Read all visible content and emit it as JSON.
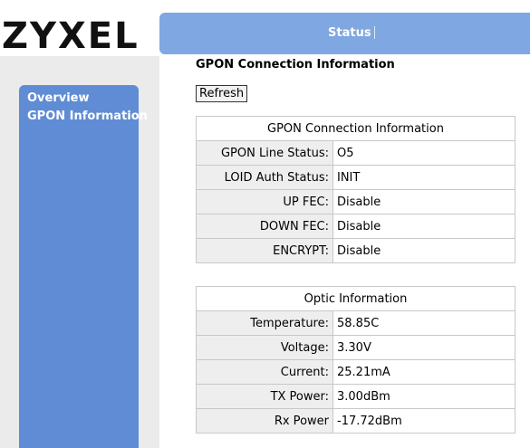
{
  "brand": {
    "logo_text": "ZYXEL"
  },
  "header": {
    "tab_status": "Status"
  },
  "sidebar": {
    "items": [
      {
        "label": "Overview"
      },
      {
        "label": "GPON Information"
      }
    ]
  },
  "main": {
    "title": "GPON Connection Information",
    "refresh_label": "Refresh",
    "gpon_table": {
      "header": "GPON Connection Information",
      "rows": [
        {
          "label": "GPON Line Status:",
          "value": "O5"
        },
        {
          "label": "LOID Auth Status:",
          "value": "INIT"
        },
        {
          "label": "UP FEC:",
          "value": "Disable"
        },
        {
          "label": "DOWN FEC:",
          "value": "Disable"
        },
        {
          "label": "ENCRYPT:",
          "value": "Disable"
        }
      ]
    },
    "optic_table": {
      "header": "Optic Information",
      "rows": [
        {
          "label": "Temperature:",
          "value": "58.85C"
        },
        {
          "label": "Voltage:",
          "value": "3.30V"
        },
        {
          "label": "Current:",
          "value": "25.21mA"
        },
        {
          "label": "TX Power:",
          "value": "3.00dBm"
        },
        {
          "label": "Rx Power",
          "value": "-17.72dBm"
        }
      ]
    }
  },
  "colors": {
    "topbar": "#7fa7e2",
    "sidebar": "#5f8cd4",
    "label_cell": "#eeeeee"
  }
}
